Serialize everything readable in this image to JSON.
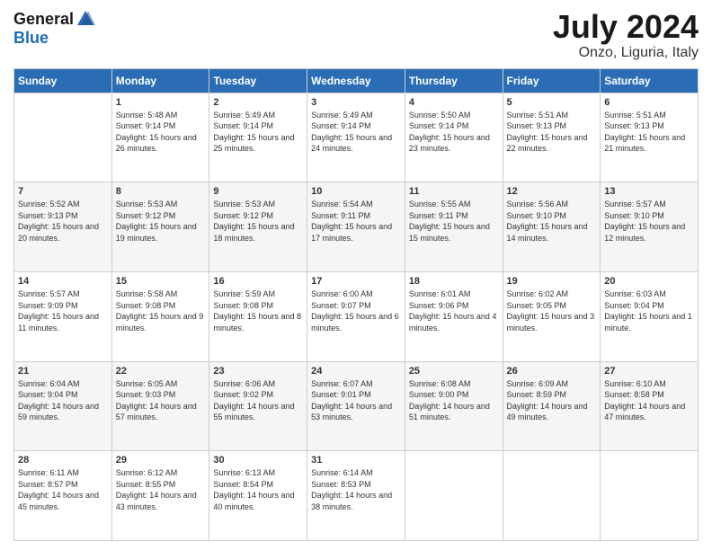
{
  "header": {
    "logo_general": "General",
    "logo_blue": "Blue",
    "month_title": "July 2024",
    "location": "Onzo, Liguria, Italy"
  },
  "weekdays": [
    "Sunday",
    "Monday",
    "Tuesday",
    "Wednesday",
    "Thursday",
    "Friday",
    "Saturday"
  ],
  "weeks": [
    [
      {
        "day": "",
        "sunrise": "",
        "sunset": "",
        "daylight": ""
      },
      {
        "day": "1",
        "sunrise": "Sunrise: 5:48 AM",
        "sunset": "Sunset: 9:14 PM",
        "daylight": "Daylight: 15 hours and 26 minutes."
      },
      {
        "day": "2",
        "sunrise": "Sunrise: 5:49 AM",
        "sunset": "Sunset: 9:14 PM",
        "daylight": "Daylight: 15 hours and 25 minutes."
      },
      {
        "day": "3",
        "sunrise": "Sunrise: 5:49 AM",
        "sunset": "Sunset: 9:14 PM",
        "daylight": "Daylight: 15 hours and 24 minutes."
      },
      {
        "day": "4",
        "sunrise": "Sunrise: 5:50 AM",
        "sunset": "Sunset: 9:14 PM",
        "daylight": "Daylight: 15 hours and 23 minutes."
      },
      {
        "day": "5",
        "sunrise": "Sunrise: 5:51 AM",
        "sunset": "Sunset: 9:13 PM",
        "daylight": "Daylight: 15 hours and 22 minutes."
      },
      {
        "day": "6",
        "sunrise": "Sunrise: 5:51 AM",
        "sunset": "Sunset: 9:13 PM",
        "daylight": "Daylight: 15 hours and 21 minutes."
      }
    ],
    [
      {
        "day": "7",
        "sunrise": "Sunrise: 5:52 AM",
        "sunset": "Sunset: 9:13 PM",
        "daylight": "Daylight: 15 hours and 20 minutes."
      },
      {
        "day": "8",
        "sunrise": "Sunrise: 5:53 AM",
        "sunset": "Sunset: 9:12 PM",
        "daylight": "Daylight: 15 hours and 19 minutes."
      },
      {
        "day": "9",
        "sunrise": "Sunrise: 5:53 AM",
        "sunset": "Sunset: 9:12 PM",
        "daylight": "Daylight: 15 hours and 18 minutes."
      },
      {
        "day": "10",
        "sunrise": "Sunrise: 5:54 AM",
        "sunset": "Sunset: 9:11 PM",
        "daylight": "Daylight: 15 hours and 17 minutes."
      },
      {
        "day": "11",
        "sunrise": "Sunrise: 5:55 AM",
        "sunset": "Sunset: 9:11 PM",
        "daylight": "Daylight: 15 hours and 15 minutes."
      },
      {
        "day": "12",
        "sunrise": "Sunrise: 5:56 AM",
        "sunset": "Sunset: 9:10 PM",
        "daylight": "Daylight: 15 hours and 14 minutes."
      },
      {
        "day": "13",
        "sunrise": "Sunrise: 5:57 AM",
        "sunset": "Sunset: 9:10 PM",
        "daylight": "Daylight: 15 hours and 12 minutes."
      }
    ],
    [
      {
        "day": "14",
        "sunrise": "Sunrise: 5:57 AM",
        "sunset": "Sunset: 9:09 PM",
        "daylight": "Daylight: 15 hours and 11 minutes."
      },
      {
        "day": "15",
        "sunrise": "Sunrise: 5:58 AM",
        "sunset": "Sunset: 9:08 PM",
        "daylight": "Daylight: 15 hours and 9 minutes."
      },
      {
        "day": "16",
        "sunrise": "Sunrise: 5:59 AM",
        "sunset": "Sunset: 9:08 PM",
        "daylight": "Daylight: 15 hours and 8 minutes."
      },
      {
        "day": "17",
        "sunrise": "Sunrise: 6:00 AM",
        "sunset": "Sunset: 9:07 PM",
        "daylight": "Daylight: 15 hours and 6 minutes."
      },
      {
        "day": "18",
        "sunrise": "Sunrise: 6:01 AM",
        "sunset": "Sunset: 9:06 PM",
        "daylight": "Daylight: 15 hours and 4 minutes."
      },
      {
        "day": "19",
        "sunrise": "Sunrise: 6:02 AM",
        "sunset": "Sunset: 9:05 PM",
        "daylight": "Daylight: 15 hours and 3 minutes."
      },
      {
        "day": "20",
        "sunrise": "Sunrise: 6:03 AM",
        "sunset": "Sunset: 9:04 PM",
        "daylight": "Daylight: 15 hours and 1 minute."
      }
    ],
    [
      {
        "day": "21",
        "sunrise": "Sunrise: 6:04 AM",
        "sunset": "Sunset: 9:04 PM",
        "daylight": "Daylight: 14 hours and 59 minutes."
      },
      {
        "day": "22",
        "sunrise": "Sunrise: 6:05 AM",
        "sunset": "Sunset: 9:03 PM",
        "daylight": "Daylight: 14 hours and 57 minutes."
      },
      {
        "day": "23",
        "sunrise": "Sunrise: 6:06 AM",
        "sunset": "Sunset: 9:02 PM",
        "daylight": "Daylight: 14 hours and 55 minutes."
      },
      {
        "day": "24",
        "sunrise": "Sunrise: 6:07 AM",
        "sunset": "Sunset: 9:01 PM",
        "daylight": "Daylight: 14 hours and 53 minutes."
      },
      {
        "day": "25",
        "sunrise": "Sunrise: 6:08 AM",
        "sunset": "Sunset: 9:00 PM",
        "daylight": "Daylight: 14 hours and 51 minutes."
      },
      {
        "day": "26",
        "sunrise": "Sunrise: 6:09 AM",
        "sunset": "Sunset: 8:59 PM",
        "daylight": "Daylight: 14 hours and 49 minutes."
      },
      {
        "day": "27",
        "sunrise": "Sunrise: 6:10 AM",
        "sunset": "Sunset: 8:58 PM",
        "daylight": "Daylight: 14 hours and 47 minutes."
      }
    ],
    [
      {
        "day": "28",
        "sunrise": "Sunrise: 6:11 AM",
        "sunset": "Sunset: 8:57 PM",
        "daylight": "Daylight: 14 hours and 45 minutes."
      },
      {
        "day": "29",
        "sunrise": "Sunrise: 6:12 AM",
        "sunset": "Sunset: 8:55 PM",
        "daylight": "Daylight: 14 hours and 43 minutes."
      },
      {
        "day": "30",
        "sunrise": "Sunrise: 6:13 AM",
        "sunset": "Sunset: 8:54 PM",
        "daylight": "Daylight: 14 hours and 40 minutes."
      },
      {
        "day": "31",
        "sunrise": "Sunrise: 6:14 AM",
        "sunset": "Sunset: 8:53 PM",
        "daylight": "Daylight: 14 hours and 38 minutes."
      },
      {
        "day": "",
        "sunrise": "",
        "sunset": "",
        "daylight": ""
      },
      {
        "day": "",
        "sunrise": "",
        "sunset": "",
        "daylight": ""
      },
      {
        "day": "",
        "sunrise": "",
        "sunset": "",
        "daylight": ""
      }
    ]
  ]
}
